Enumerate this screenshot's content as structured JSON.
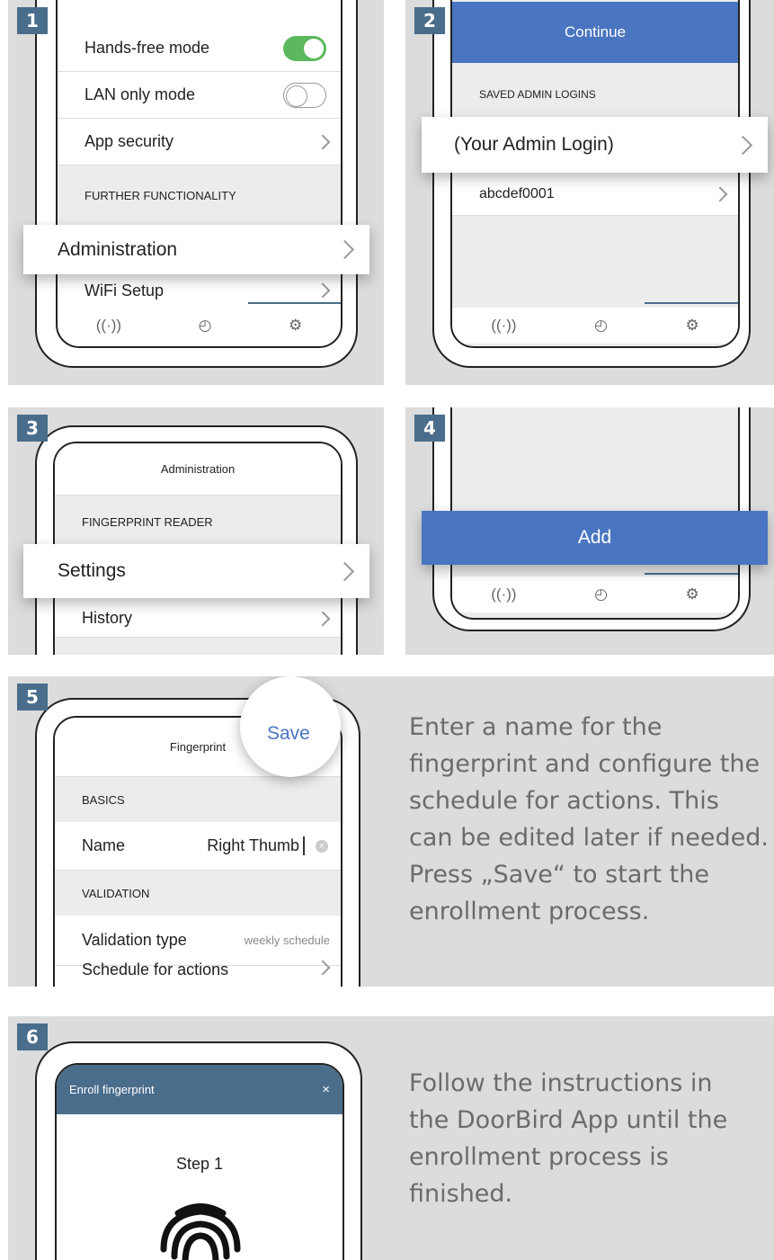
{
  "panel1": {
    "badge": "1",
    "rows": [
      "Hands-free mode",
      "LAN only mode",
      "App security"
    ],
    "section": "FURTHER FUNCTIONALITY",
    "highlight": "Administration",
    "wifi": "WiFi Setup",
    "toggles": {
      "hands_free_on": true,
      "lan_only_on": false
    },
    "accent_green": "#5cb85c"
  },
  "panel2": {
    "badge": "2",
    "continue_label": "Continue",
    "section": "SAVED ADMIN LOGINS",
    "highlight": "(Your Admin Login)",
    "login_item": "abcdef0001"
  },
  "panel3": {
    "badge": "3",
    "title": "Administration",
    "section": "FINGERPRINT READER",
    "highlight": "Settings",
    "history": "History"
  },
  "panel4": {
    "badge": "4",
    "add_label": "Add"
  },
  "panel5": {
    "badge": "5",
    "title": "Fingerprint",
    "save_label": "Save",
    "section_basics": "BASICS",
    "name_label": "Name",
    "name_value": "Right Thumb",
    "section_validation": "VALIDATION",
    "validation_label": "Validation type",
    "validation_value": "weekly schedule",
    "schedule_label": "Schedule for actions",
    "description": "Enter a name for the fingerprint and configure the schedule for actions. This can be edited later if needed. Press „Save“ to start the enrollment process."
  },
  "panel6": {
    "badge": "6",
    "dialog_title": "Enroll fingerprint",
    "close": "×",
    "step": "Step 1",
    "description": "Follow the instructions in the DoorBird App until the enrollment process is finished."
  },
  "tab_icons": [
    "broadcast-icon",
    "clock-icon",
    "gear-icon"
  ],
  "colors": {
    "badge": "#4a6d8c",
    "primary_blue": "#4a75c0",
    "save_text": "#4a75c0"
  }
}
